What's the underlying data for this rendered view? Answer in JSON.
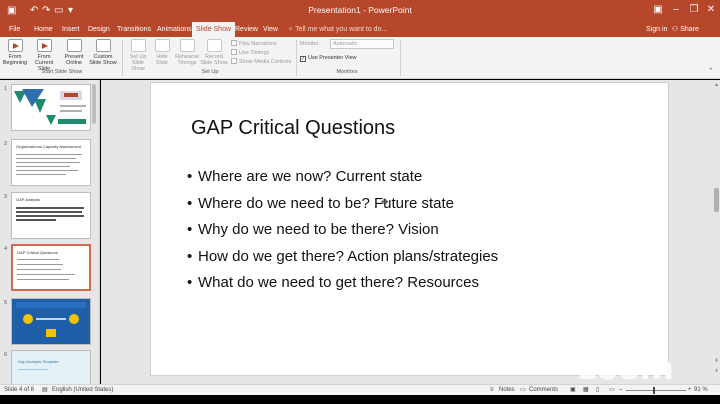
{
  "titlebar": {
    "title": "Presentation1 - PowerPoint",
    "quick_access": [
      "save-icon",
      "undo-icon",
      "redo-icon",
      "present-icon",
      "customize-icon"
    ],
    "window_buttons": [
      "ribbon-display-icon",
      "minimize-icon",
      "restore-icon",
      "close-icon"
    ]
  },
  "tabs": [
    {
      "label": "File"
    },
    {
      "label": "Home"
    },
    {
      "label": "Insert"
    },
    {
      "label": "Design"
    },
    {
      "label": "Transitions"
    },
    {
      "label": "Animations"
    },
    {
      "label": "Slide Show",
      "active": true
    },
    {
      "label": "Review"
    },
    {
      "label": "View"
    }
  ],
  "tellme": "Tell me what you want to do...",
  "signin": "Sign in",
  "share": "Share",
  "ribbon": {
    "start_group": {
      "label": "Start Slide Show",
      "buttons": [
        {
          "label": "From Beginning"
        },
        {
          "label": "From Current Slide"
        },
        {
          "label": "Present Online"
        },
        {
          "label": "Custom Slide Show"
        }
      ]
    },
    "setup_group": {
      "label": "Set Up",
      "buttons": [
        {
          "label": "Set Up Slide Show"
        },
        {
          "label": "Hide Slide"
        },
        {
          "label": "Rehearse Timings"
        },
        {
          "label": "Record Slide Show"
        }
      ],
      "checks": [
        {
          "label": "Play Narrations",
          "checked": false
        },
        {
          "label": "Use Timings",
          "checked": false
        },
        {
          "label": "Show Media Controls",
          "checked": false
        }
      ]
    },
    "monitors_group": {
      "label": "Monitors",
      "monitor_label": "Monitor:",
      "monitor_value": "Automatic",
      "presenter_view": {
        "label": "Use Presenter View",
        "checked": true
      }
    }
  },
  "thumbnails": [
    {
      "num": "1"
    },
    {
      "num": "2",
      "title": "Organizational Capacity Assessment"
    },
    {
      "num": "3",
      "title": "GAP Analysis"
    },
    {
      "num": "4",
      "title": "GAP Critical Questions",
      "selected": true
    },
    {
      "num": "5"
    },
    {
      "num": "6",
      "title": "Gap Analysis Template"
    }
  ],
  "slide": {
    "title": "GAP Critical Questions",
    "bullets": [
      "Where are we now? Current state",
      "Where do we need to be? Future state",
      "Why do we need to be there? Vision",
      "How do we get there?  Action plans/strategies",
      "What do we need to get there? Resources"
    ]
  },
  "watermark": "zoom",
  "statusbar": {
    "slide_info": "Slide 4 of 8",
    "language": "English (United States)",
    "notes": "Notes",
    "comments": "Comments",
    "zoom_pct": "91 %"
  },
  "colors": {
    "accent": "#b7472a",
    "ribbon_bg": "#f3f3f3",
    "pane_bg": "#e6e6e6"
  }
}
